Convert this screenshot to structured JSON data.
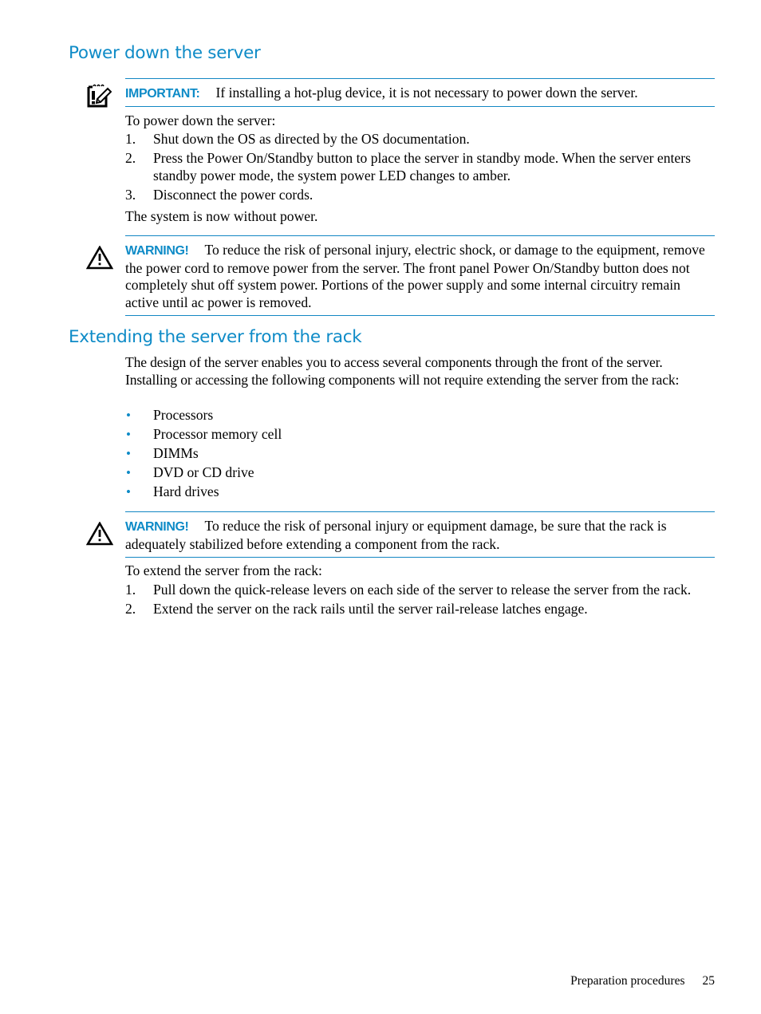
{
  "sections": [
    {
      "title": "Power down the server",
      "important": {
        "label": "IMPORTANT:",
        "text": "If installing a hot-plug device, it is not necessary to power down the server.",
        "icon": "notepad-pencil-icon"
      },
      "intro": "To power down the server:",
      "steps": [
        {
          "num": "1.",
          "text": "Shut down the OS as directed by the OS documentation."
        },
        {
          "num": "2.",
          "text": "Press the Power On/Standby button to place the server in standby mode. When the server enters standby power mode, the system power LED changes to amber."
        },
        {
          "num": "3.",
          "text": "Disconnect the power cords."
        }
      ],
      "outro": "The system is now without power.",
      "warning": {
        "label": "WARNING!",
        "text": "To reduce the risk of personal injury, electric shock, or damage to the equipment, remove the power cord to remove power from the server. The front panel Power On/Standby button does not completely shut off system power. Portions of the power supply and some internal circuitry remain active until ac power is removed.",
        "icon": "warning-triangle-icon"
      }
    },
    {
      "title": "Extending the server from the rack",
      "intro": "The design of the server enables you to access several components through the front of the server. Installing or accessing the following components will not require extending the server from the rack:",
      "bullets": [
        "Processors",
        "Processor memory cell",
        "DIMMs",
        "DVD or CD drive",
        "Hard drives"
      ],
      "bullet_glyph": "•",
      "warning": {
        "label": "WARNING!",
        "text": "To reduce the risk of personal injury or equipment damage, be sure that the rack is adequately stabilized before extending a component from the rack.",
        "icon": "warning-triangle-icon"
      },
      "steps_intro": "To extend the server from the rack:",
      "steps": [
        {
          "num": "1.",
          "text": "Pull down the quick-release levers on each side of the server to release the server from the rack."
        },
        {
          "num": "2.",
          "text": "Extend the server on the rack rails until the server rail-release latches engage."
        }
      ]
    }
  ],
  "footer": {
    "section": "Preparation procedures",
    "page_number": "25"
  },
  "colors": {
    "accent": "#0e8bc7",
    "rule": "#1387c3",
    "text": "#000000"
  }
}
